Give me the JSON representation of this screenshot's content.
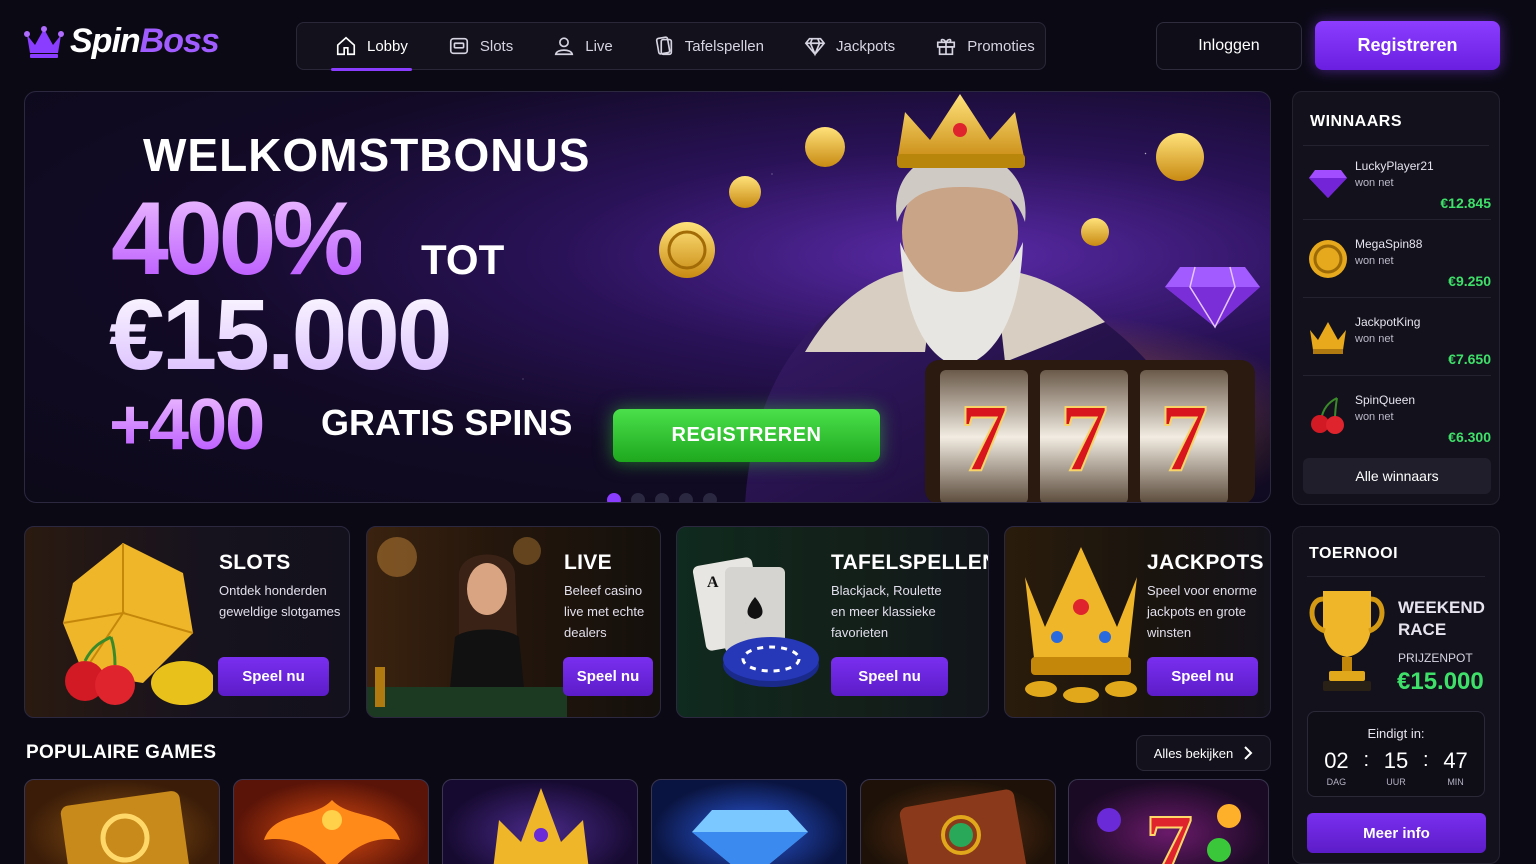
{
  "header": {
    "logo": {
      "part1": "Spin",
      "part2": "Boss",
      "icon": "crown-icon"
    },
    "nav": [
      {
        "label": "Lobby",
        "icon": "home-icon",
        "active": true
      },
      {
        "label": "Slots",
        "icon": "slot-machine-icon"
      },
      {
        "label": "Live",
        "icon": "user-icon"
      },
      {
        "label": "Tafelspellen",
        "icon": "cards-icon"
      },
      {
        "label": "Jackpots",
        "icon": "diamond-icon"
      },
      {
        "label": "Promoties",
        "icon": "gift-icon"
      }
    ],
    "login_label": "Inloggen",
    "register_label": "Registreren"
  },
  "hero": {
    "welcome": "WELKOMSTBONUS",
    "percent": "400%",
    "tot": "TOT",
    "amount": "€15.000",
    "spins_num": "+400",
    "spins_label": "GRATIS SPINS",
    "cta": "REGISTREREN",
    "slides": 5,
    "active_slide": 1,
    "reel_symbols": [
      "7",
      "7",
      "7"
    ]
  },
  "winners": {
    "title": "WINNAARS",
    "won_label": "won net",
    "items": [
      {
        "name": "LuckyPlayer21",
        "amount": "€12.845",
        "icon": "gem-icon"
      },
      {
        "name": "MegaSpin88",
        "amount": "€9.250",
        "icon": "coin-icon"
      },
      {
        "name": "JackpotKing",
        "amount": "€7.650",
        "icon": "crown-icon"
      },
      {
        "name": "SpinQueen",
        "amount": "€6.300",
        "icon": "cherry-icon"
      }
    ],
    "all_label": "Alle winnaars"
  },
  "categories": [
    {
      "title": "SLOTS",
      "desc": [
        "Ontdek honderden",
        "geweldige slotgames"
      ],
      "button": "Speel nu"
    },
    {
      "title": "LIVE",
      "desc": [
        "Beleef casino",
        "live met echte",
        "dealers"
      ],
      "button": "Speel nu"
    },
    {
      "title": "TAFELSPELLEN",
      "desc": [
        "Blackjack, Roulette",
        "en meer klassieke",
        "favorieten"
      ],
      "button": "Speel nu"
    },
    {
      "title": "JACKPOTS",
      "desc": [
        "Speel voor enorme",
        "jackpots en grote",
        "winsten"
      ],
      "button": "Speel nu"
    }
  ],
  "tournament": {
    "title": "TOERNOOI",
    "name_line1": "WEEKEND",
    "name_line2": "RACE",
    "pot_label": "PRIJZENPOT",
    "pot": "€15.000",
    "ends_label": "Eindigt in:",
    "days": "02",
    "days_label": "DAG",
    "hours": "15",
    "hours_label": "UUR",
    "mins": "47",
    "mins_label": "MIN",
    "more_label": "Meer info"
  },
  "popular": {
    "title": "POPULAIRE GAMES",
    "all_label": "Alles bekijken",
    "games": [
      {
        "art": "golden-book"
      },
      {
        "art": "phoenix"
      },
      {
        "art": "golden-crown"
      },
      {
        "art": "blue-diamond"
      },
      {
        "art": "jeweled-book"
      },
      {
        "art": "fruit-seven"
      }
    ]
  },
  "colors": {
    "accent": "#8b3dff",
    "win": "#3fe06a",
    "cta_green": "#2fc42f",
    "bg": "#0b0a14"
  }
}
